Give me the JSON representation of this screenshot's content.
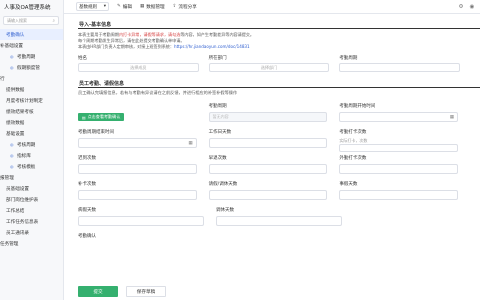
{
  "app": {
    "title": "人事及OA管理系统"
  },
  "search": {
    "placeholder": "请输入搜索"
  },
  "sidebar": {
    "items": [
      {
        "label": "考勤确认",
        "level": "sub",
        "active": true
      },
      {
        "label": "补基础设置",
        "level": "top"
      },
      {
        "label": "考勤周期",
        "level": "sub2"
      },
      {
        "label": "假期额度管",
        "level": "sub2"
      },
      {
        "label": "行",
        "level": "top"
      },
      {
        "label": "提供数据",
        "level": "sub"
      },
      {
        "label": "月度考核计划制定",
        "level": "sub"
      },
      {
        "label": "绩效结果考核",
        "level": "sub"
      },
      {
        "label": "绩效数据",
        "level": "sub"
      },
      {
        "label": "基础设置",
        "level": "sub"
      },
      {
        "label": "考核周期",
        "level": "sub2"
      },
      {
        "label": "指标库",
        "level": "sub2"
      },
      {
        "label": "考核模板",
        "level": "sub2"
      },
      {
        "label": "报管理",
        "level": "top"
      },
      {
        "label": "员基础设置",
        "level": "sub"
      },
      {
        "label": "部门岗位维护表",
        "level": "sub"
      },
      {
        "label": "工作总结",
        "level": "sub"
      },
      {
        "label": "工作任务信息表",
        "level": "sub"
      },
      {
        "label": "员工通讯录",
        "level": "sub"
      },
      {
        "label": "任务管理",
        "level": "top"
      }
    ]
  },
  "toolbar": {
    "select_value": "基数规则",
    "edit": "编辑",
    "data_mgmt": "数据管理",
    "help": "流程分享"
  },
  "form": {
    "section1_title": "导入-基本信息",
    "notice1_pre": "本表主要用于考勤周期",
    "notice1_red": "内打卡异常，请假等请求，请勾选",
    "notice1_post": "等内容，如产生考勤差异等内容请提交。",
    "notice2": "每个周期考勤发生异常后，请在此处提交考勤确认单申请。",
    "notice3_pre": "本表由HR部门负责人定期审核，对接上班签到系统：",
    "notice3_link": "https://hr.jiandaoyun.com/doc/14831",
    "name_label": "姓名",
    "name_placeholder": "选择成员",
    "dept_label": "所在部门",
    "dept_placeholder": "选择部门",
    "period_label": "考勤周期",
    "period_placeholder": "",
    "section2_title": "员工考勤、请假信息",
    "desc2": "员工确认完填报信息，若有与考勤有异议请在之前反馈，并进行相应的补签补假等操作",
    "import_btn": "点击查看考勤确认",
    "period2_label": "考勤周期",
    "period2_value": "暂无内容",
    "period_start_label": "考勤周期开始时间",
    "period_end_label": "考勤周期结束时间",
    "workdays_label": "工作日天数",
    "days_label": "考勤打卡次数",
    "days_hint": "实际打卡，次数",
    "late_label": "迟到次数",
    "early_label": "早退次数",
    "absent_label": "外勤打卡次数",
    "missing_label": "补卡次数",
    "leave_label": "请假/调休天数",
    "personal_label": "事假天数",
    "sick_label": "病假天数",
    "annual_label": "调休天数",
    "confirm_label": "考勤确认"
  },
  "footer": {
    "submit": "提交",
    "save": "保存草稿"
  },
  "colors": {
    "accent": "#35b06f",
    "primary": "#2f5fd0"
  }
}
